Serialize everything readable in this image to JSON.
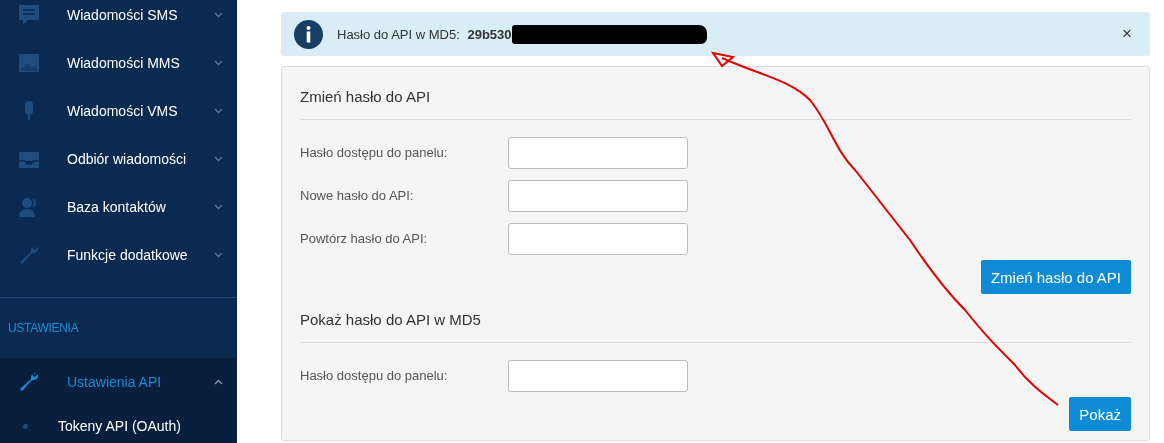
{
  "sidebar": {
    "items": [
      {
        "kind": "sms",
        "label": "Wiadomości SMS",
        "expanded": false,
        "selected": false
      },
      {
        "kind": "mms",
        "label": "Wiadomości MMS",
        "expanded": false,
        "selected": false
      },
      {
        "kind": "vms",
        "label": "Wiadomości VMS",
        "expanded": false,
        "selected": false
      },
      {
        "kind": "inbox",
        "label": "Odbiór wiadomości",
        "expanded": false,
        "selected": false
      },
      {
        "kind": "contacts",
        "label": "Baza kontaktów",
        "expanded": false,
        "selected": false
      },
      {
        "kind": "tools",
        "label": "Funkcje dodatkowe",
        "expanded": false,
        "selected": false
      }
    ],
    "section_heading": "USTAWIENIA",
    "settings_items": [
      {
        "kind": "tools",
        "label": "Ustawienia API",
        "expanded": true,
        "selected": true,
        "children": [
          {
            "label": "Tokeny API (OAuth)"
          }
        ]
      }
    ]
  },
  "alert": {
    "label": "Hasło do API w MD5:",
    "value": "29b530",
    "close": "×"
  },
  "sections": [
    {
      "title": "Zmień hasło do API",
      "fields": [
        {
          "label": "Hasło dostępu do panelu:"
        },
        {
          "label": "Nowe hasło do API:"
        },
        {
          "label": "Powtórz hasło do API:"
        }
      ],
      "button": "Zmień hasło do API"
    },
    {
      "title": "Pokaż hasło do API w MD5",
      "fields": [
        {
          "label": "Hasło dostępu do panelu:"
        }
      ],
      "button": "Pokaż"
    }
  ]
}
